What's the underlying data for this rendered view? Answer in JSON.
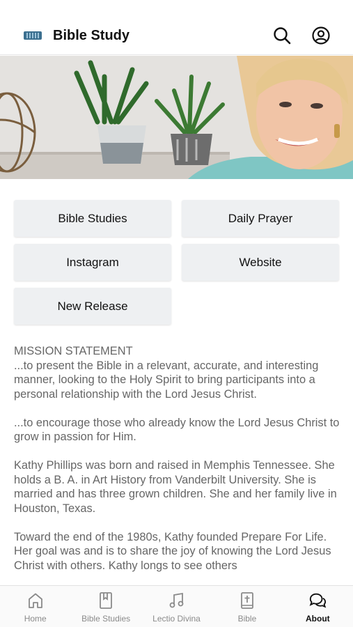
{
  "header": {
    "title": "Bible Study",
    "logo_icon": "app-logo-icon",
    "search_icon": "search-icon",
    "account_icon": "account-circle-icon"
  },
  "hero": {
    "description_icon": "hero-photo"
  },
  "links": [
    {
      "label": "Bible Studies"
    },
    {
      "label": "Daily Prayer"
    },
    {
      "label": "Instagram"
    },
    {
      "label": "Website"
    },
    {
      "label": "New Release"
    }
  ],
  "content": {
    "heading": "MISSION STATEMENT",
    "paragraph1": "...to present the Bible in a relevant, accurate, and interesting manner, looking to the Holy Spirit to bring participants into a personal relationship with the Lord Jesus Christ.",
    "paragraph2": "...to encourage those who already know the Lord Jesus Christ to grow in passion for Him.",
    "paragraph3": "Kathy Phillips was born and raised in Memphis Tennessee. She holds a B. A. in Art History from Vanderbilt University. She is married and has three grown children. She and her family live in Houston, Texas.",
    "paragraph4": "Toward the end of the 1980s, Kathy founded Prepare For Life. Her goal was and is to share the joy of knowing the Lord Jesus Christ with others. Kathy longs to see others"
  },
  "tabs": [
    {
      "label": "Home",
      "icon": "home-icon"
    },
    {
      "label": "Bible Studies",
      "icon": "bookmark-book-icon"
    },
    {
      "label": "Lectio Divina",
      "icon": "music-note-icon"
    },
    {
      "label": "Bible",
      "icon": "bible-cross-icon"
    },
    {
      "label": "About",
      "icon": "chat-bubbles-icon",
      "active": true
    }
  ],
  "colors": {
    "button_bg": "#eef0f2",
    "text_muted": "#666666",
    "tab_inactive": "#8a8a8a",
    "tab_active": "#111111"
  }
}
